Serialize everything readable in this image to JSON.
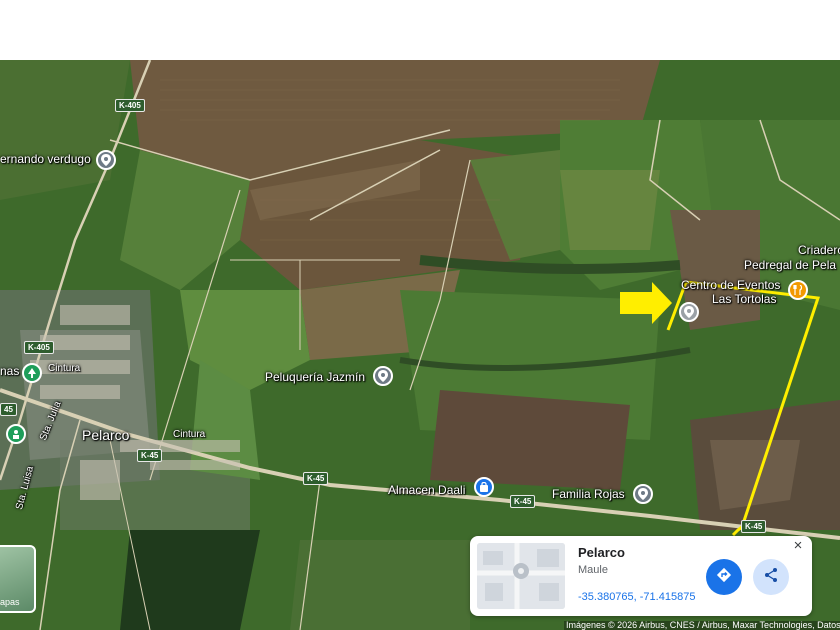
{
  "map": {
    "view": "satellite",
    "labels": {
      "fernando_verdugo": "ernando verdugo",
      "criadero": "Criadero",
      "pedregal": "Pedregal de Pela",
      "centro_eventos": "Centro de Eventos",
      "las_tortolas": "Las Tortolas",
      "peluqueria": "Peluquería Jazmín",
      "almacen": "Almacen Daali",
      "familia_rojas": "Familia Rojas",
      "pelarco": "Pelarco",
      "cintura_1": "Cintura",
      "cintura_2": "Cintura",
      "sta_julia": "Sta. Julia",
      "sta_luisa": "Sta. Luisa",
      "left_cut": "nas"
    },
    "road_shields": {
      "k405_top": "K-405",
      "k405_left": "K-405",
      "k45_left": "K-45",
      "k45_center": "K-45",
      "k45_mid": "K-45",
      "k45_right": "K-45",
      "k5_edge": "45"
    },
    "annotation": {
      "arrow_color": "#ffee00",
      "outline_color": "#ffee00"
    },
    "icons": {
      "place_pin": "location-pin-icon",
      "shop_pin": "shopping-bag-icon",
      "restaurant_pin": "restaurant-icon",
      "selected_pin": "selected-location-icon"
    }
  },
  "layers": {
    "label": "apas"
  },
  "place_card": {
    "title": "Pelarco",
    "subtitle": "Maule",
    "coordinates": "-35.380765, -71.415875",
    "directions_icon": "directions-icon",
    "share_icon": "share-icon",
    "close_label": "×"
  },
  "attribution": "Imágenes © 2026 Airbus, CNES / Airbus, Maxar Technologies, Datos"
}
